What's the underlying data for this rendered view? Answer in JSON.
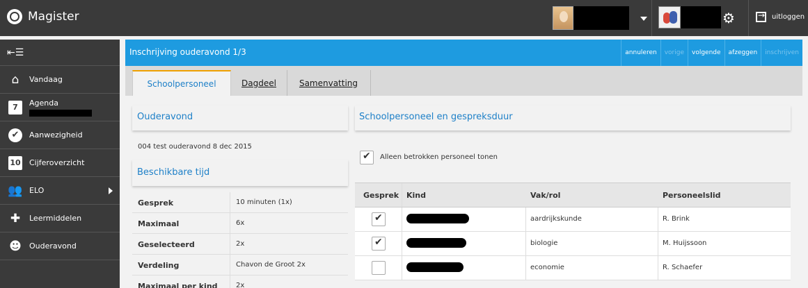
{
  "app": {
    "name": "Magister"
  },
  "topbar": {
    "logout_label": "uitloggen"
  },
  "sidebar": {
    "items": [
      {
        "label": "Vandaag"
      },
      {
        "label": "Agenda"
      },
      {
        "label": "Aanwezigheid"
      },
      {
        "label": "Cijferoverzicht"
      },
      {
        "label": "ELO"
      },
      {
        "label": "Leermiddelen"
      },
      {
        "label": "Ouderavond"
      }
    ],
    "cijfer_icon_text": "10",
    "agenda_icon_text": "7"
  },
  "header": {
    "title": "Inschrijving ouderavond 1/3",
    "actions": [
      {
        "label": "annuleren",
        "enabled": true
      },
      {
        "label": "vorige",
        "enabled": false
      },
      {
        "label": "volgende",
        "enabled": true
      },
      {
        "label": "afzeggen",
        "enabled": true
      },
      {
        "label": "inschrijven",
        "enabled": false
      }
    ]
  },
  "tabs": [
    {
      "label": "Schoolpersoneel",
      "active": true
    },
    {
      "label": "Dagdeel",
      "active": false
    },
    {
      "label": "Samenvatting",
      "active": false
    }
  ],
  "left_panel": {
    "title": "Ouderavond",
    "event": "004 test ouderavond 8 dec 2015",
    "section_title": "Beschikbare tijd",
    "rows": [
      {
        "key": "Gesprek",
        "value": "10 minuten (1x)"
      },
      {
        "key": "Maximaal",
        "value": "6x"
      },
      {
        "key": "Geselecteerd",
        "value": "2x"
      },
      {
        "key": "Verdeling",
        "value": "Chavon de Groot 2x"
      },
      {
        "key": "Maximaal per kind",
        "value": "2x"
      }
    ]
  },
  "right_panel": {
    "title": "Schoolpersoneel en gespreksduur",
    "filter_label": "Alleen betrokken personeel tonen",
    "filter_checked": true,
    "columns": [
      "Gesprek",
      "Kind",
      "Vak/rol",
      "Personeelslid"
    ],
    "rows": [
      {
        "checked": true,
        "vak": "aardrijkskunde",
        "personeel": "R. Brink"
      },
      {
        "checked": true,
        "vak": "biologie",
        "personeel": "M. Huijssoon"
      },
      {
        "checked": false,
        "vak": "economie",
        "personeel": "R. Schaefer"
      }
    ]
  },
  "colors": {
    "accent": "#1e9be0",
    "dark": "#3a3a3a",
    "tab_highlight": "#f0a000",
    "link": "#1e80c8"
  }
}
